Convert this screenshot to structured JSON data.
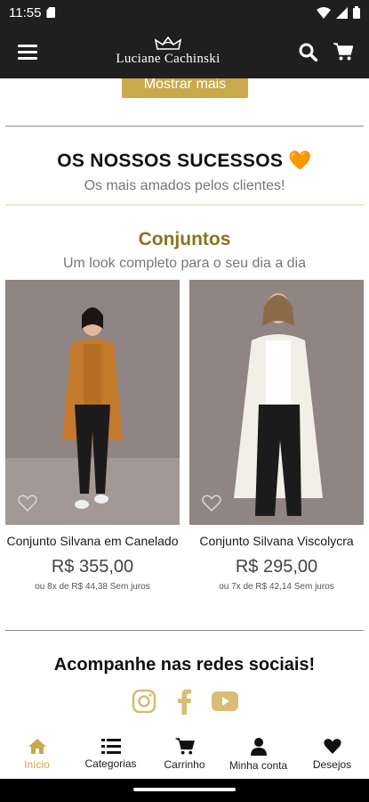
{
  "status": {
    "time": "11:55"
  },
  "header": {
    "brand": "Luciane Cachinski"
  },
  "show_more_label": "Mostrar mais",
  "success_section": {
    "title": "OS NOSSOS SUCESSOS 🧡",
    "subtitle": "Os mais amados pelos clientes!"
  },
  "category": {
    "title": "Conjuntos",
    "subtitle": "Um look completo para o seu dia a dia"
  },
  "products": [
    {
      "name": "Conjunto Silvana em Canelado",
      "price": "R$ 355,00",
      "installments": "ou 8x de R$ 44,38 Sem juros",
      "outfit_color": "#c47a2c"
    },
    {
      "name": "Conjunto Silvana Viscolycra",
      "price": "R$ 295,00",
      "installments": "ou 7x de R$ 42,14 Sem juros",
      "outfit_color": "#f2efe6"
    }
  ],
  "social": {
    "title": "Acompanhe nas redes sociais!",
    "icons": [
      "instagram-icon",
      "facebook-icon",
      "youtube-icon"
    ]
  },
  "bottom_nav": [
    {
      "label": "Início",
      "icon": "home-icon",
      "active": true
    },
    {
      "label": "Categorias",
      "icon": "list-icon"
    },
    {
      "label": "Carrinho",
      "icon": "cart-icon"
    },
    {
      "label": "Minha conta",
      "icon": "user-icon"
    },
    {
      "label": "Desejos",
      "icon": "heart-icon"
    }
  ],
  "colors": {
    "accent": "#c8a94c",
    "header_bg": "#1f1f1f",
    "category_title": "#8a7520"
  }
}
